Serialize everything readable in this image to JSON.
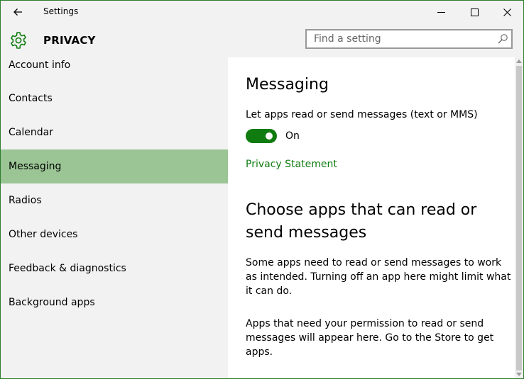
{
  "window": {
    "title": "Settings",
    "accent_color": "#107c10"
  },
  "header": {
    "section_title": "PRIVACY",
    "icon": "gear-icon",
    "search": {
      "placeholder": "Find a setting",
      "value": ""
    }
  },
  "sidebar": {
    "items": [
      {
        "label": "Account info"
      },
      {
        "label": "Contacts"
      },
      {
        "label": "Calendar"
      },
      {
        "label": "Messaging",
        "active": true
      },
      {
        "label": "Radios"
      },
      {
        "label": "Other devices"
      },
      {
        "label": "Feedback & diagnostics"
      },
      {
        "label": "Background apps"
      }
    ],
    "active_color": "#9bc595"
  },
  "content": {
    "heading": "Messaging",
    "setting_label": "Let apps read or send messages (text or MMS)",
    "toggle_state": "On",
    "privacy_link": "Privacy Statement",
    "subheading": "Choose apps that can read or send messages",
    "paragraph1": "Some apps need to read or send messages to work as intended. Turning off an app here might limit what it can do.",
    "paragraph2": "Apps that need your permission to read or send messages will appear here. Go to the Store to get apps."
  }
}
